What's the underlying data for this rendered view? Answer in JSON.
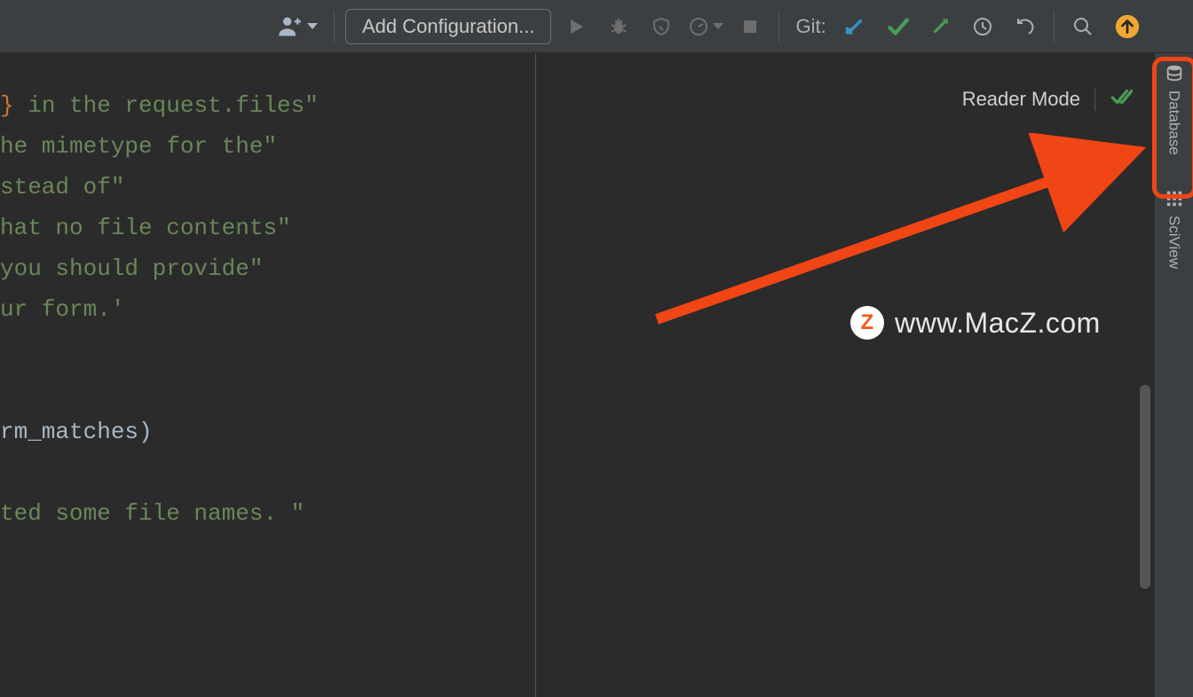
{
  "toolbar": {
    "add_configuration_label": "Add Configuration...",
    "git_label": "Git:"
  },
  "editor": {
    "reader_mode_label": "Reader Mode",
    "lines": [
      {
        "brace": "}",
        "text": " in the request.files\""
      },
      {
        "text": "he mimetype for the\""
      },
      {
        "text": "stead of\""
      },
      {
        "text": "hat no file contents\""
      },
      {
        "text": " you should provide\""
      },
      {
        "text": "ur form.'"
      },
      {
        "text": ""
      },
      {
        "text": ""
      },
      {
        "plain": "rm_matches)"
      },
      {
        "text": ""
      },
      {
        "text": "ted some file names. \""
      }
    ]
  },
  "side_tools": {
    "database_label": "Database",
    "sciview_label": "SciView"
  },
  "watermark": {
    "z": "Z",
    "text": "www.MacZ.com"
  }
}
